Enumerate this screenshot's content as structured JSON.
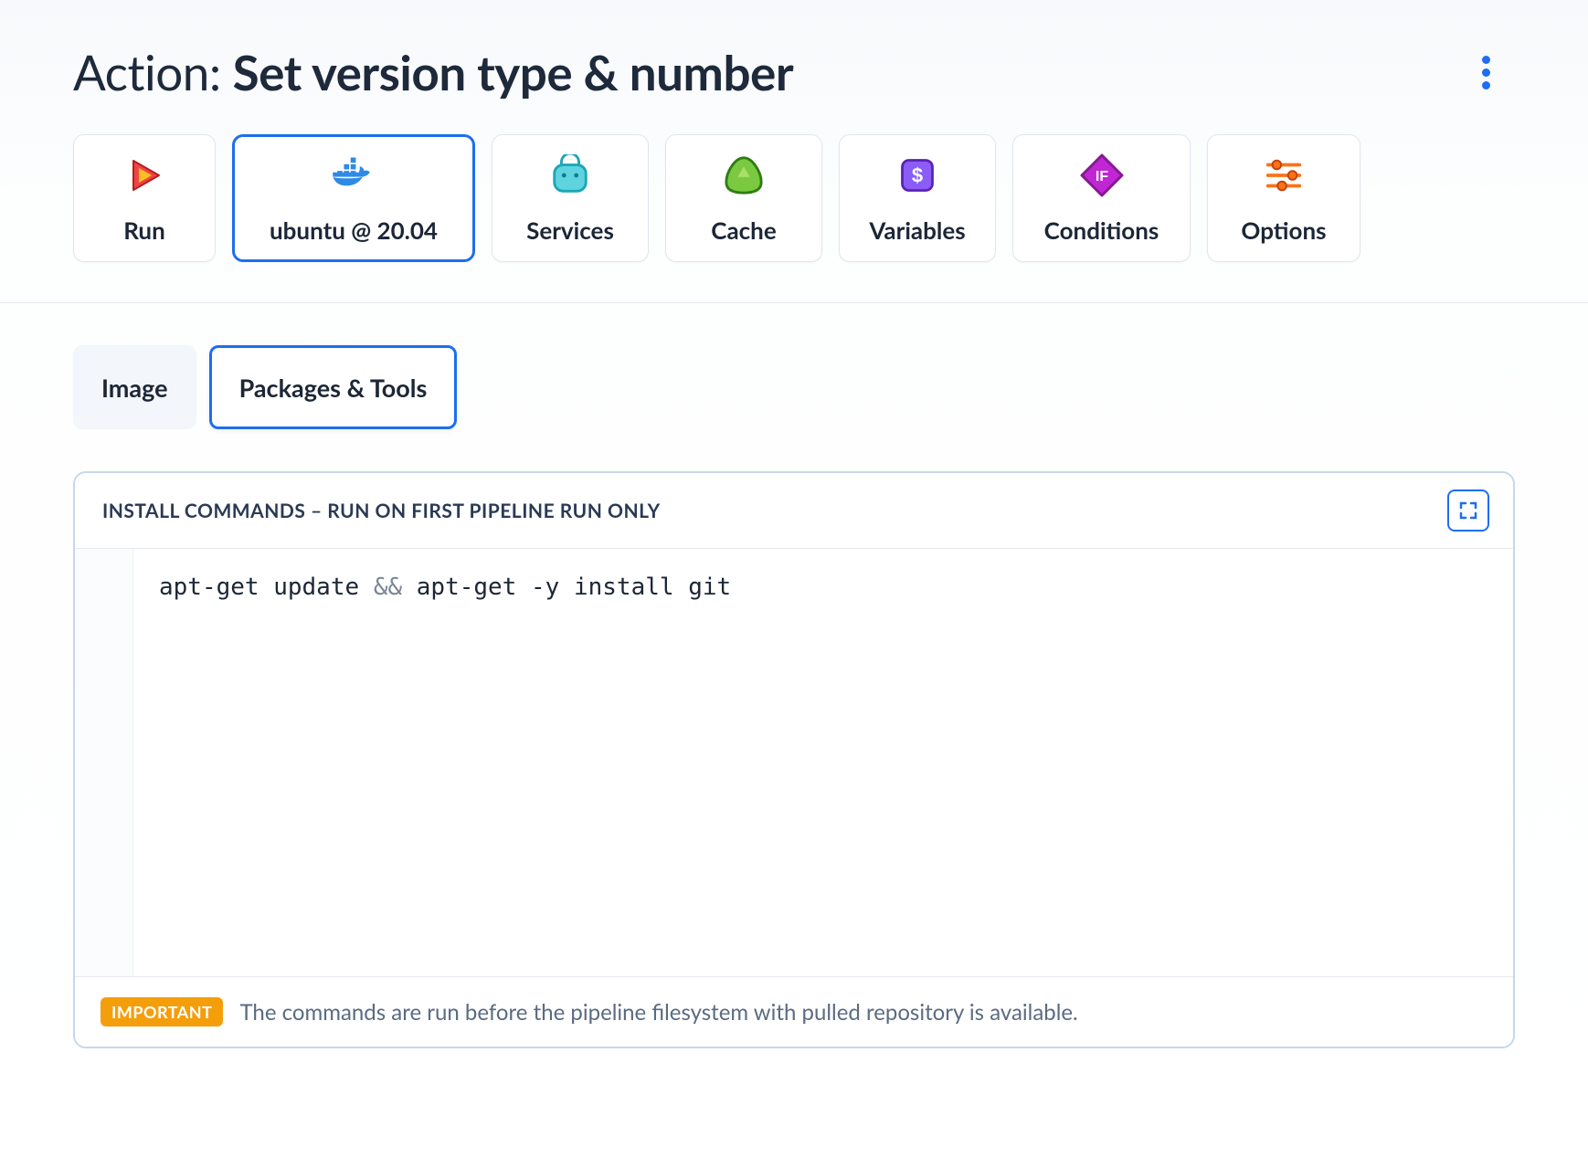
{
  "header": {
    "prefix": "Action: ",
    "title_bold": "Set version type & number"
  },
  "top_tabs": [
    {
      "id": "run",
      "label": "Run",
      "icon": "play-icon"
    },
    {
      "id": "env",
      "label": "ubuntu @ 20.04",
      "icon": "docker-icon"
    },
    {
      "id": "services",
      "label": "Services",
      "icon": "package-icon"
    },
    {
      "id": "cache",
      "label": "Cache",
      "icon": "blob-icon"
    },
    {
      "id": "variables",
      "label": "Variables",
      "icon": "dollar-icon"
    },
    {
      "id": "conditions",
      "label": "Conditions",
      "icon": "diamond-if-icon"
    },
    {
      "id": "options",
      "label": "Options",
      "icon": "sliders-icon"
    }
  ],
  "top_tabs_active": "env",
  "sub_tabs": [
    {
      "id": "image",
      "label": "Image"
    },
    {
      "id": "pkgs",
      "label": "Packages & Tools"
    }
  ],
  "sub_tabs_active": "pkgs",
  "editor": {
    "header_label": "Install commands – run on first pipeline run only",
    "code_plain_1": "apt-get update ",
    "code_op": "&&",
    "code_plain_2": " apt-get -y install git"
  },
  "footer": {
    "badge": "IMPORTANT",
    "text": "The commands are run before the pipeline filesystem with pulled repository is available."
  }
}
